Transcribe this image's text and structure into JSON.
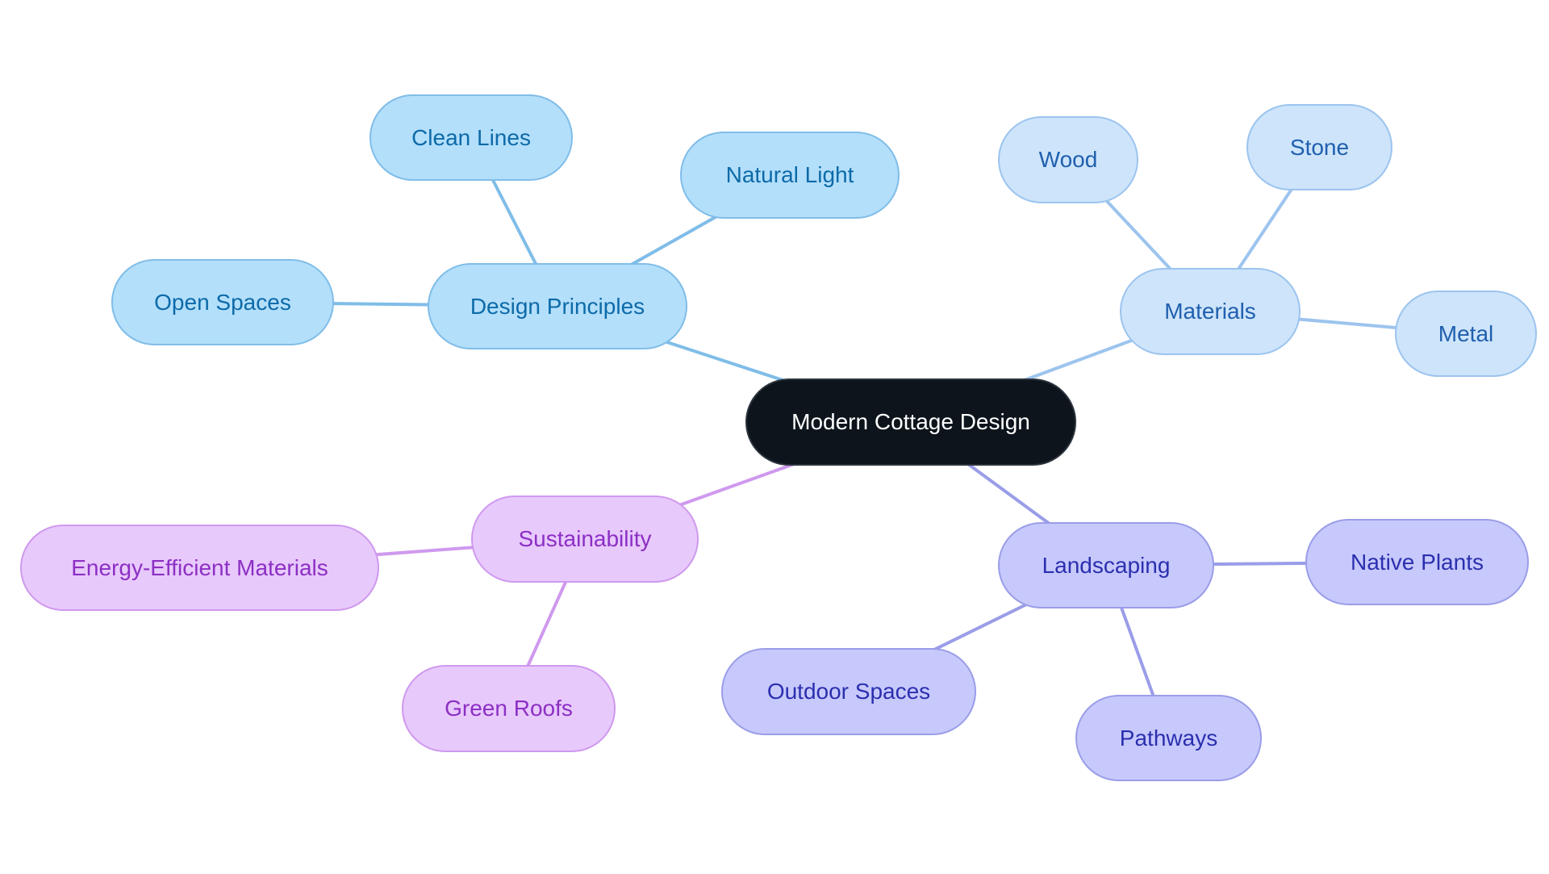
{
  "diagram": {
    "type": "mindmap",
    "root": {
      "id": "root",
      "label": "Modern Cottage Design"
    },
    "branches": [
      {
        "id": "design",
        "label": "Design Principles",
        "group": "blue",
        "edge_color": "#80bde8",
        "children": [
          {
            "id": "clean",
            "label": "Clean Lines"
          },
          {
            "id": "light",
            "label": "Natural Light"
          },
          {
            "id": "open",
            "label": "Open Spaces"
          }
        ]
      },
      {
        "id": "materials",
        "label": "Materials",
        "group": "lblue",
        "edge_color": "#9cc4ee",
        "children": [
          {
            "id": "wood",
            "label": "Wood"
          },
          {
            "id": "stone",
            "label": "Stone"
          },
          {
            "id": "metal",
            "label": "Metal"
          }
        ]
      },
      {
        "id": "sustain",
        "label": "Sustainability",
        "group": "purple",
        "edge_color": "#cf99ee",
        "children": [
          {
            "id": "energy",
            "label": "Energy-Efficient Materials"
          },
          {
            "id": "roofs",
            "label": "Green Roofs"
          }
        ]
      },
      {
        "id": "landscape",
        "label": "Landscaping",
        "group": "indigo",
        "edge_color": "#9a9de8",
        "children": [
          {
            "id": "native",
            "label": "Native Plants"
          },
          {
            "id": "outdoor",
            "label": "Outdoor Spaces"
          },
          {
            "id": "paths",
            "label": "Pathways"
          }
        ]
      }
    ],
    "colors": {
      "root_fill": "#0d141c",
      "blue_fill": "#b3dffb",
      "light_blue_fill": "#cde4fb",
      "purple_fill": "#e8c9fc",
      "indigo_fill": "#c7c9fc"
    }
  }
}
